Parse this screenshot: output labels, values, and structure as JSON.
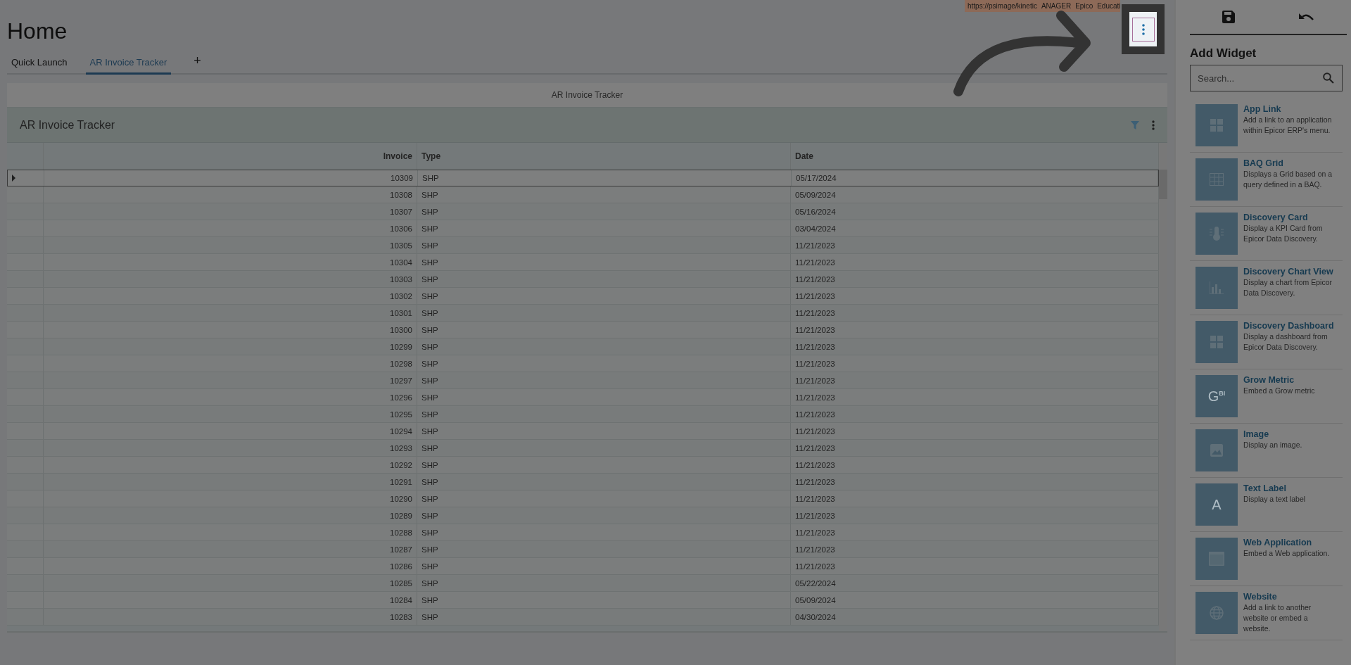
{
  "address_bar": {
    "segments": [
      "https://psimage/kinetic",
      "ANAGER",
      "Epico",
      "Educati"
    ]
  },
  "page": {
    "title": "Home"
  },
  "tabs": [
    {
      "label": "Quick Launch",
      "selected": false
    },
    {
      "label": "AR Invoice Tracker",
      "selected": true
    },
    {
      "label": "+",
      "kind": "add"
    }
  ],
  "panel": {
    "caption": "AR Invoice Tracker",
    "card_title": "AR Invoice Tracker"
  },
  "table": {
    "columns": [
      "Invoice",
      "Type",
      "Date"
    ],
    "rows": [
      {
        "cells": [
          "10309",
          "SHP",
          "05/17/2024"
        ],
        "selected": true
      },
      {
        "cells": [
          "10308",
          "SHP",
          "05/09/2024"
        ],
        "selected": false
      },
      {
        "cells": [
          "10307",
          "SHP",
          "05/16/2024"
        ],
        "selected": false
      },
      {
        "cells": [
          "10306",
          "SHP",
          "03/04/2024"
        ],
        "selected": false
      },
      {
        "cells": [
          "10305",
          "SHP",
          "11/21/2023"
        ],
        "selected": false
      },
      {
        "cells": [
          "10304",
          "SHP",
          "11/21/2023"
        ],
        "selected": false
      },
      {
        "cells": [
          "10303",
          "SHP",
          "11/21/2023"
        ],
        "selected": false
      },
      {
        "cells": [
          "10302",
          "SHP",
          "11/21/2023"
        ],
        "selected": false
      },
      {
        "cells": [
          "10301",
          "SHP",
          "11/21/2023"
        ],
        "selected": false
      },
      {
        "cells": [
          "10300",
          "SHP",
          "11/21/2023"
        ],
        "selected": false
      },
      {
        "cells": [
          "10299",
          "SHP",
          "11/21/2023"
        ],
        "selected": false
      },
      {
        "cells": [
          "10298",
          "SHP",
          "11/21/2023"
        ],
        "selected": false
      },
      {
        "cells": [
          "10297",
          "SHP",
          "11/21/2023"
        ],
        "selected": false
      },
      {
        "cells": [
          "10296",
          "SHP",
          "11/21/2023"
        ],
        "selected": false
      },
      {
        "cells": [
          "10295",
          "SHP",
          "11/21/2023"
        ],
        "selected": false
      },
      {
        "cells": [
          "10294",
          "SHP",
          "11/21/2023"
        ],
        "selected": false
      },
      {
        "cells": [
          "10293",
          "SHP",
          "11/21/2023"
        ],
        "selected": false
      },
      {
        "cells": [
          "10292",
          "SHP",
          "11/21/2023"
        ],
        "selected": false
      },
      {
        "cells": [
          "10291",
          "SHP",
          "11/21/2023"
        ],
        "selected": false
      },
      {
        "cells": [
          "10290",
          "SHP",
          "11/21/2023"
        ],
        "selected": false
      },
      {
        "cells": [
          "10289",
          "SHP",
          "11/21/2023"
        ],
        "selected": false
      },
      {
        "cells": [
          "10288",
          "SHP",
          "11/21/2023"
        ],
        "selected": false
      },
      {
        "cells": [
          "10287",
          "SHP",
          "11/21/2023"
        ],
        "selected": false
      },
      {
        "cells": [
          "10286",
          "SHP",
          "11/21/2023"
        ],
        "selected": false
      },
      {
        "cells": [
          "10285",
          "SHP",
          "05/22/2024"
        ],
        "selected": false
      },
      {
        "cells": [
          "10284",
          "SHP",
          "05/09/2024"
        ],
        "selected": false
      },
      {
        "cells": [
          "10283",
          "SHP",
          "04/30/2024"
        ],
        "selected": false
      }
    ]
  },
  "sidebar": {
    "heading": "Add Widget",
    "search": {
      "placeholder": "Search..."
    },
    "widgets": [
      {
        "title": "App Link",
        "description": "Add a link to an application within Epicor ERP's menu."
      },
      {
        "title": "BAQ Grid",
        "description": "Displays a Grid based on a query defined in a BAQ."
      },
      {
        "title": "Discovery Card",
        "description": "Display a KPI Card from Epicor Data Discovery."
      },
      {
        "title": "Discovery Chart View",
        "description": "Display a chart from Epicor Data Discovery."
      },
      {
        "title": "Discovery Dashboard",
        "description": "Display a dashboard from Epicor Data Discovery."
      },
      {
        "title": "Grow Metric",
        "description": "Embed a Grow metric",
        "icon_text": "G$^{BI}$"
      },
      {
        "title": "Image",
        "description": "Display an image."
      },
      {
        "title": "Text Label",
        "description": "Display a text label",
        "icon_text": "A"
      },
      {
        "title": "Web Application",
        "description": "Embed a Web application."
      },
      {
        "title": "Website",
        "description": "Add a link to another website or embed a website."
      }
    ]
  }
}
